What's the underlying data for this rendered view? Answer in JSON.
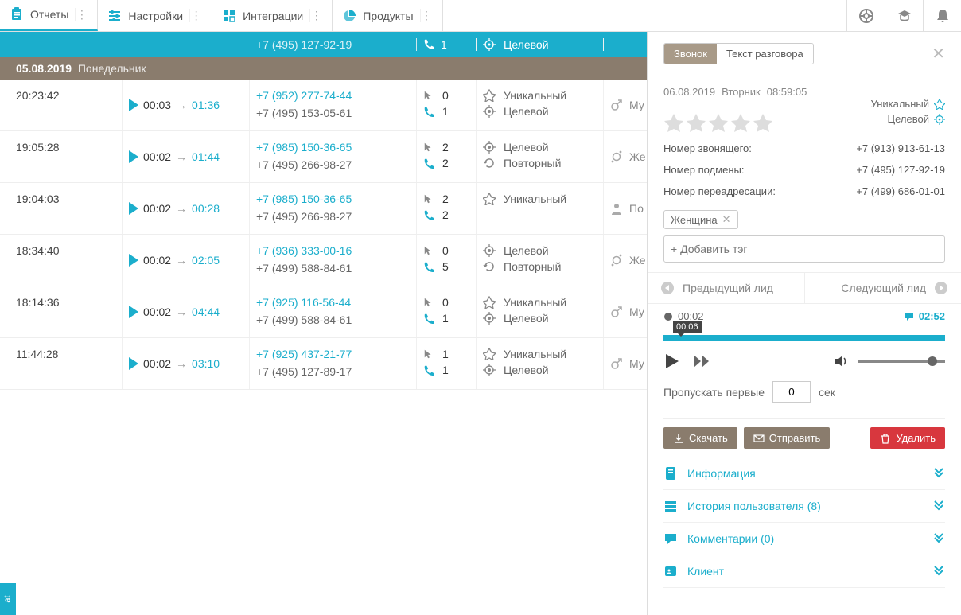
{
  "nav": {
    "items": [
      {
        "label": "Отчеты"
      },
      {
        "label": "Настройки"
      },
      {
        "label": "Интеграции"
      },
      {
        "label": "Продукты"
      }
    ]
  },
  "teal_row": {
    "phone": "+7 (495) 127-92-19",
    "out": "1",
    "tag": "Целевой"
  },
  "sep": {
    "date": "05.08.2019",
    "day": "Понедельник"
  },
  "rows": [
    {
      "time": "20:23:42",
      "dur_wait": "00:03",
      "dur_talk": "01:36",
      "phone": "+7 (952) 277-74-44",
      "phone2": "+7 (495) 153-05-61",
      "out": "0",
      "in": "1",
      "tags": [
        "Уникальный",
        "Целевой"
      ],
      "gender": "Му"
    },
    {
      "time": "19:05:28",
      "dur_wait": "00:02",
      "dur_talk": "01:44",
      "phone": "+7 (985) 150-36-65",
      "phone2": "+7 (495) 266-98-27",
      "out": "2",
      "in": "2",
      "tags": [
        "Целевой",
        "Повторный"
      ],
      "gender": "Же"
    },
    {
      "time": "19:04:03",
      "dur_wait": "00:02",
      "dur_talk": "00:28",
      "phone": "+7 (985) 150-36-65",
      "phone2": "+7 (495) 266-98-27",
      "out": "2",
      "in": "2",
      "tags": [
        "Уникальный"
      ],
      "gender": "По"
    },
    {
      "time": "18:34:40",
      "dur_wait": "00:02",
      "dur_talk": "02:05",
      "phone": "+7 (936) 333-00-16",
      "phone2": "+7 (499) 588-84-61",
      "out": "0",
      "in": "5",
      "tags": [
        "Целевой",
        "Повторный"
      ],
      "gender": "Же"
    },
    {
      "time": "18:14:36",
      "dur_wait": "00:02",
      "dur_talk": "04:44",
      "phone": "+7 (925) 116-56-44",
      "phone2": "+7 (499) 588-84-61",
      "out": "0",
      "in": "1",
      "tags": [
        "Уникальный",
        "Целевой"
      ],
      "gender": "Му"
    },
    {
      "time": "11:44:28",
      "dur_wait": "00:02",
      "dur_talk": "03:10",
      "phone": "+7 (925) 437-21-77",
      "phone2": "+7 (495) 127-89-17",
      "out": "1",
      "in": "1",
      "tags": [
        "Уникальный",
        "Целевой"
      ],
      "gender": "Му"
    }
  ],
  "side": {
    "tabs": {
      "call": "Звонок",
      "transcript": "Текст разговора"
    },
    "meta": {
      "date": "06.08.2019",
      "day": "Вторник",
      "time": "08:59:05"
    },
    "badges": {
      "unique": "Уникальный",
      "target": "Целевой"
    },
    "info": {
      "caller_l": "Номер звонящего:",
      "caller_v": "+7 (913) 913-61-13",
      "sub_l": "Номер подмены:",
      "sub_v": "+7 (495) 127-92-19",
      "fwd_l": "Номер переадресации:",
      "fwd_v": "+7 (499) 686-01-01"
    },
    "tag_chip": "Женщина",
    "tag_placeholder": "+ Добавить тэг",
    "leadnav": {
      "prev": "Предыдущий лид",
      "next": "Следующий лид"
    },
    "player": {
      "pos": "00:02",
      "tooltip": "00:06",
      "total": "02:52"
    },
    "skip": {
      "label": "Пропускать первые",
      "value": "0",
      "unit": "сек"
    },
    "btns": {
      "download": "Скачать",
      "send": "Отправить",
      "delete": "Удалить"
    },
    "acc": {
      "info": "Информация",
      "history": "История пользователя (8)",
      "comments": "Комментарии (0)",
      "client": "Клиент"
    }
  },
  "chat_tab": "at"
}
